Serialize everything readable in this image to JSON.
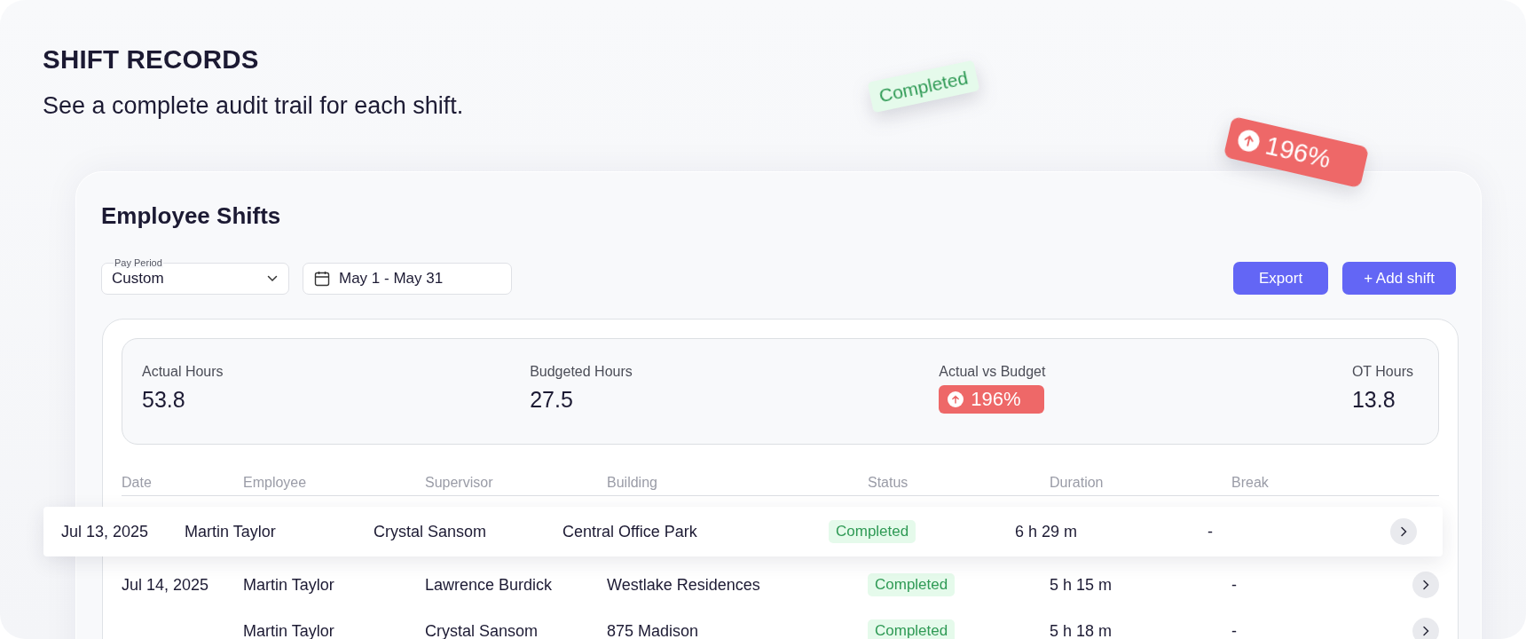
{
  "header": {
    "title": "SHIFT RECORDS",
    "subtitle": "See a complete audit trail for each shift."
  },
  "floating_badges": [
    {
      "kind": "status",
      "label": "Completed"
    },
    {
      "kind": "trend",
      "label": "196%"
    }
  ],
  "panel": {
    "title": "Employee Shifts",
    "pay_period": {
      "label": "Pay Period",
      "value": "Custom"
    },
    "date_range": {
      "value": "May 1 - May 31"
    },
    "buttons": [
      "Export",
      "+ Add shift"
    ]
  },
  "summary": [
    {
      "kind": "number",
      "label": "Actual Hours",
      "value": "53.8"
    },
    {
      "kind": "number",
      "label": "Budgeted Hours",
      "value": "27.5"
    },
    {
      "kind": "trend",
      "label": "Actual vs Budget",
      "value": "196%"
    },
    {
      "kind": "number",
      "label": "OT Hours",
      "value": "13.8"
    }
  ],
  "table": {
    "columns": [
      "Date",
      "Employee",
      "Supervisor",
      "Building",
      "Status",
      "Duration",
      "Break"
    ],
    "rows": [
      {
        "highlighted": true,
        "date": "Jul 13, 2025",
        "employee": "Martin Taylor",
        "supervisor": "Crystal Sansom",
        "building": "Central Office Park",
        "status": "Completed",
        "duration": "6 h 29 m",
        "break": "-"
      },
      {
        "highlighted": false,
        "date": "Jul 14, 2025",
        "employee": "Martin Taylor",
        "supervisor": "Lawrence Burdick",
        "building": "Westlake Residences",
        "status": "Completed",
        "duration": "5 h 15 m",
        "break": "-"
      },
      {
        "highlighted": false,
        "employee": "Martin Taylor",
        "supervisor": "Crystal Sansom",
        "building": "875 Madison",
        "status": "Completed",
        "duration": "5 h 18 m",
        "break": "-"
      }
    ]
  }
}
